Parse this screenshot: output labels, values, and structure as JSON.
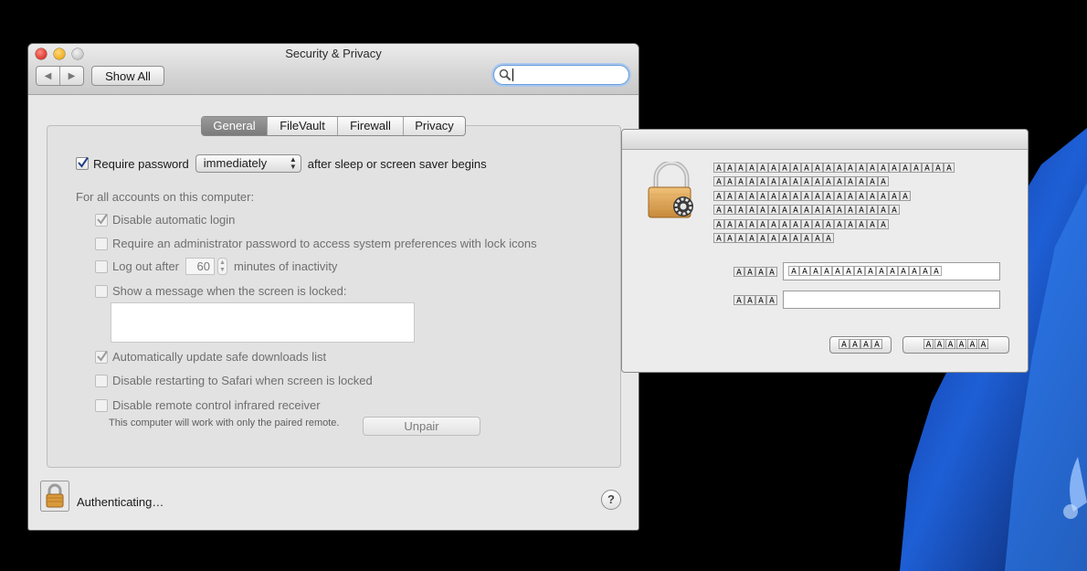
{
  "window": {
    "title": "Security & Privacy",
    "back_label": "◀",
    "forward_label": "▶",
    "show_all_label": "Show All",
    "search_placeholder": ""
  },
  "tabs": [
    {
      "label": "General",
      "selected": true
    },
    {
      "label": "FileVault",
      "selected": false
    },
    {
      "label": "Firewall",
      "selected": false
    },
    {
      "label": "Privacy",
      "selected": false
    }
  ],
  "general": {
    "require_password": {
      "checked": true,
      "label": "Require password",
      "select_value": "immediately",
      "suffix": "after sleep or screen saver begins"
    },
    "all_accounts_heading": "For all accounts on this computer:",
    "disable_auto_login": {
      "checked": true,
      "label": "Disable automatic login"
    },
    "require_admin": {
      "checked": false,
      "label": "Require an administrator password to access system preferences with lock icons"
    },
    "logout": {
      "checked": false,
      "label": "Log out after",
      "minutes": "60",
      "suffix": "minutes of inactivity"
    },
    "show_message": {
      "checked": false,
      "label": "Show a message when the screen is locked:",
      "message": ""
    },
    "auto_update": {
      "checked": true,
      "label": "Automatically update safe downloads list"
    },
    "disable_safari": {
      "checked": false,
      "label": "Disable restarting to Safari when screen is locked"
    },
    "disable_ir": {
      "checked": false,
      "label": "Disable remote control infrared receiver"
    },
    "ir_note": "This computer will work with only the paired remote.",
    "unpair_label": "Unpair"
  },
  "footer": {
    "status": "Authenticating…",
    "help_label": "?"
  },
  "auth_dialog": {
    "message_lines": [
      "🄰🄰🄰🄰🄰🄰🄰🄰🄰🄰🄰🄰🄰🄰🄰🄰🄰🄰🄰🄰🄰🄰",
      "🄰🄰🄰🄰🄰🄰🄰🄰🄰🄰🄰🄰🄰🄰🄰🄰",
      "🄰🄰🄰🄰🄰🄰🄰🄰🄰🄰🄰🄰🄰🄰🄰🄰🄰🄰",
      "🄰🄰🄰🄰🄰🄰🄰🄰🄰🄰🄰🄰🄰🄰🄰🄰🄰",
      "🄰🄰🄰🄰🄰🄰🄰🄰🄰🄰🄰🄰🄰🄰🄰🄰",
      "🄰🄰🄰🄰🄰🄰🄰🄰🄰🄰🄰"
    ],
    "name_label": "🄰🄰🄰🄰",
    "name_value": "🄰🄰🄰🄰🄰🄰🄰🄰🄰🄰🄰🄰🄰🄰",
    "password_label": "🄰🄰🄰🄰",
    "password_value": "",
    "cancel_label": "🄰🄰🄰🄰",
    "ok_label": "🄰🄰🄰🄰🄰🄰"
  }
}
